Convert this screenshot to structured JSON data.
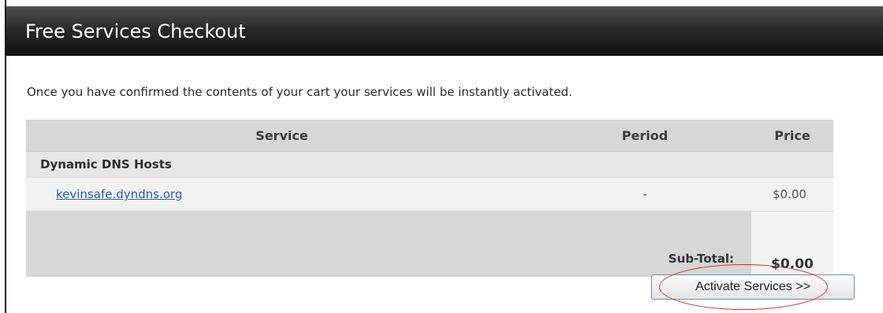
{
  "header": {
    "title": "Free Services Checkout"
  },
  "intro": {
    "text": "Once you have confirmed the contents of your cart your services will be instantly activated."
  },
  "table": {
    "columns": [
      "Service",
      "Period",
      "Price"
    ],
    "group": "Dynamic DNS Hosts",
    "items": [
      {
        "service": "kevinsafe.dyndns.org",
        "period": "-",
        "price": "$0.00"
      }
    ],
    "subtotal_label": "Sub-Total:",
    "subtotal_value": "$0.00"
  },
  "actions": {
    "activate_label": "Activate Services >>"
  },
  "colors": {
    "header_bg": "#1a1a1a",
    "link": "#2a5db0",
    "highlight": "#cc3333"
  }
}
